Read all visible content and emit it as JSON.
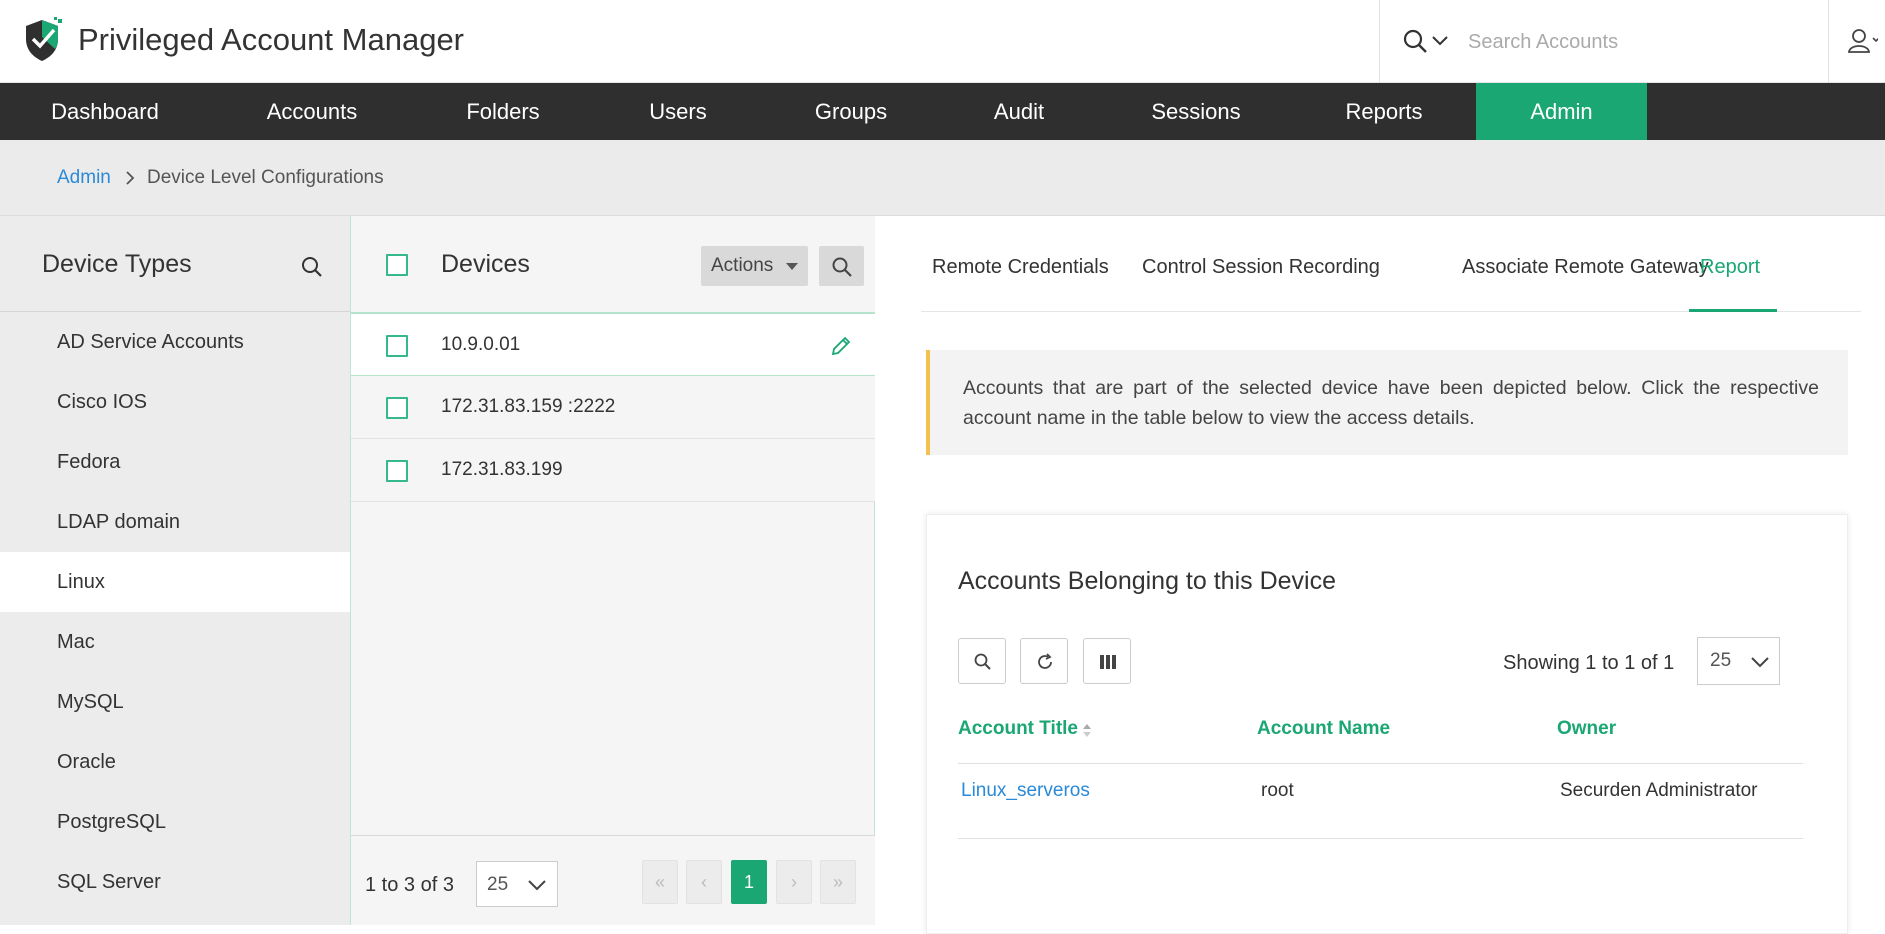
{
  "app": {
    "title": "Privileged Account Manager",
    "brand_color": "#1aa774"
  },
  "search": {
    "placeholder": "Search Accounts"
  },
  "nav": [
    {
      "label": "Dashboard",
      "active": false
    },
    {
      "label": "Accounts",
      "active": false
    },
    {
      "label": "Folders",
      "active": false
    },
    {
      "label": "Users",
      "active": false
    },
    {
      "label": "Groups",
      "active": false
    },
    {
      "label": "Audit",
      "active": false
    },
    {
      "label": "Sessions",
      "active": false
    },
    {
      "label": "Reports",
      "active": false
    },
    {
      "label": "Admin",
      "active": true
    }
  ],
  "breadcrumb": {
    "parent": "Admin",
    "current": "Device Level Configurations"
  },
  "device_types": {
    "title": "Device Types",
    "items": [
      "AD Service Accounts",
      "Cisco IOS",
      "Fedora",
      "LDAP domain",
      "Linux",
      "Mac",
      "MySQL",
      "Oracle",
      "PostgreSQL",
      "SQL Server"
    ],
    "selected": "Linux"
  },
  "devices": {
    "title": "Devices",
    "actions_label": "Actions",
    "rows": [
      "10.9.0.01",
      "172.31.83.159 :2222",
      "172.31.83.199"
    ],
    "selected": "10.9.0.01",
    "count_text": "1 to 3 of 3",
    "page_size": "25",
    "pager": {
      "first": "«",
      "prev": "‹",
      "current": "1",
      "next": "›",
      "last": "»"
    }
  },
  "tabs": [
    {
      "label": "Remote Credentials",
      "active": false
    },
    {
      "label": "Control Session Recording",
      "active": false
    },
    {
      "label": "Associate Remote Gateway",
      "active": false
    },
    {
      "label": "Report",
      "active": true
    }
  ],
  "info": {
    "text": "Accounts that are part of the selected device have been depicted below. Click the respective account name in the table below to view the access details."
  },
  "accounts": {
    "title": "Accounts Belonging to this Device",
    "showing": "Showing 1 to 1 of 1",
    "page_size": "25",
    "columns": [
      "Account Title",
      "Account Name",
      "Owner"
    ],
    "rows": [
      {
        "title": "Linux_serveros",
        "name": "root",
        "owner": "Securden Administrator"
      }
    ]
  }
}
